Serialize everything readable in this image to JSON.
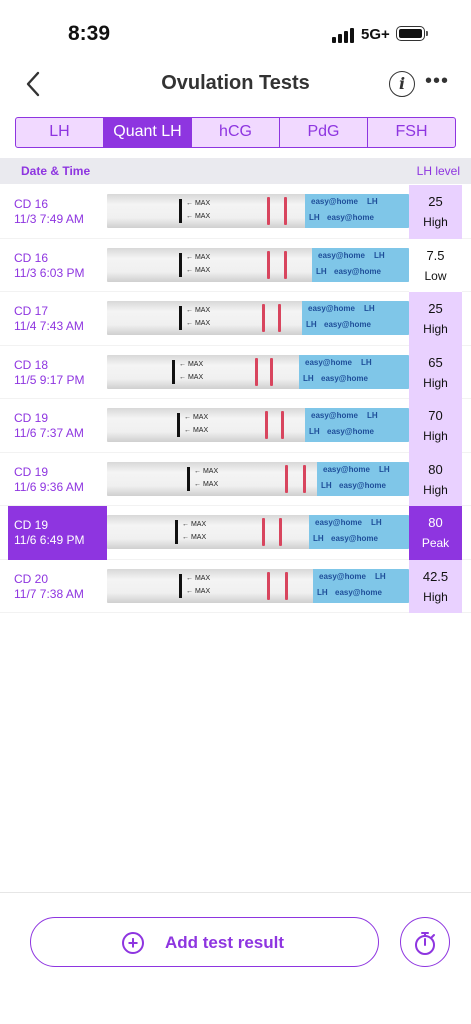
{
  "status": {
    "time": "8:39",
    "network": "5G+"
  },
  "nav": {
    "title": "Ovulation Tests",
    "info_icon": "info-icon",
    "more_icon": "more-icon"
  },
  "tabs": [
    {
      "label": "LH",
      "active": false
    },
    {
      "label": "Quant LH",
      "active": true
    },
    {
      "label": "hCG",
      "active": false
    },
    {
      "label": "PdG",
      "active": false
    },
    {
      "label": "FSH",
      "active": false
    }
  ],
  "table": {
    "header_date": "Date & Time",
    "header_level": "LH level",
    "strip_text": {
      "max": "MAX",
      "brand": "easy@home",
      "code": "LH"
    },
    "rows": [
      {
        "cd": "CD 16",
        "datetime": "11/3 7:49 AM",
        "level": "25",
        "category": "High",
        "selected": false
      },
      {
        "cd": "CD 16",
        "datetime": "11/3 6:03 PM",
        "level": "7.5",
        "category": "Low",
        "selected": false
      },
      {
        "cd": "CD 17",
        "datetime": "11/4 7:43 AM",
        "level": "25",
        "category": "High",
        "selected": false
      },
      {
        "cd": "CD 18",
        "datetime": "11/5 9:17 PM",
        "level": "65",
        "category": "High",
        "selected": false
      },
      {
        "cd": "CD 19",
        "datetime": "11/6 7:37 AM",
        "level": "70",
        "category": "High",
        "selected": false
      },
      {
        "cd": "CD 19",
        "datetime": "11/6 9:36 AM",
        "level": "80",
        "category": "High",
        "selected": false
      },
      {
        "cd": "CD 19",
        "datetime": "11/6 6:49 PM",
        "level": "80",
        "category": "Peak",
        "selected": true
      },
      {
        "cd": "CD 20",
        "datetime": "11/7 7:38 AM",
        "level": "42.5",
        "category": "High",
        "selected": false
      }
    ]
  },
  "footer": {
    "add_label": "Add test result",
    "add_icon": "plus-circle-icon",
    "timer_icon": "stopwatch-icon"
  },
  "colors": {
    "accent": "#8e35e0",
    "highlight": "#e9d1ff",
    "test_line": "#d8455e"
  }
}
